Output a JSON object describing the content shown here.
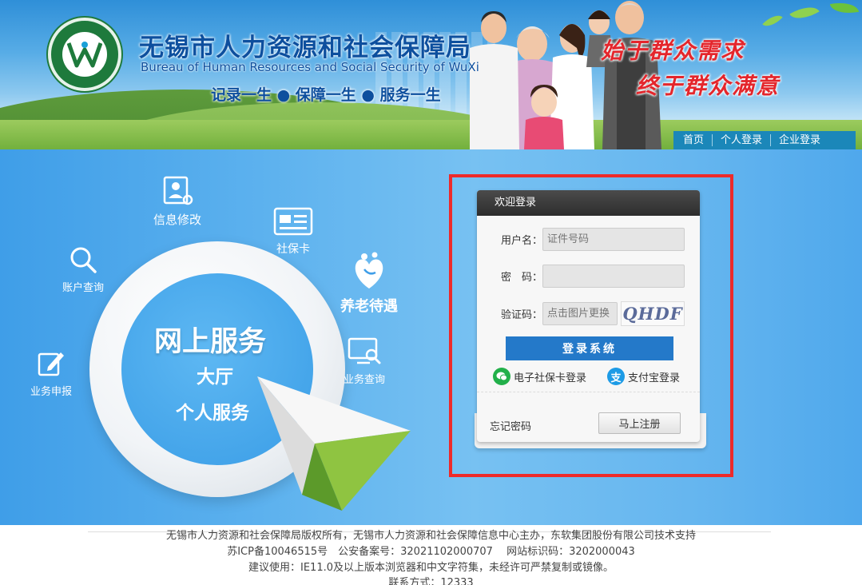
{
  "header": {
    "title_cn": "无锡市人力资源和社会保障局",
    "title_en": "Bureau of Human Resources and Social Security of WuXi",
    "slogan": "记录一生 ● 保障一生 ● 服务一生",
    "motto_line1": "始于群众需求",
    "motto_line2": "终于群众满意",
    "nav": [
      {
        "label": "首页"
      },
      {
        "label": "个人登录"
      },
      {
        "label": "企业登录"
      }
    ]
  },
  "hall": {
    "title": "网上服务",
    "sub1": "大厅",
    "sub2": "个人服务"
  },
  "services": {
    "info_modify": "信息修改",
    "social_card": "社保卡",
    "account_query": "账户查询",
    "pension": "养老待遇",
    "business_apply": "业务申报",
    "business_query": "业务查询"
  },
  "login": {
    "header": "欢迎登录",
    "username_label": "用户名：",
    "username_placeholder": "证件号码",
    "password_label": "密　码：",
    "password_placeholder": "",
    "captcha_label": "验证码：",
    "captcha_placeholder": "点击图片更换",
    "captcha_text": "QHDF",
    "submit": "登录系统",
    "ecard_login": "电子社保卡登录",
    "alipay_login": "支付宝登录",
    "forgot": "忘记密码",
    "register": "马上注册"
  },
  "footer": {
    "line1": "无锡市人力资源和社会保障局版权所有，无锡市人力资源和社会保障信息中心主办，东软集团股份有限公司技术支持",
    "line2": "苏ICP备10046515号　公安备案号：32021102000707　 网站标识码：3202000043",
    "line3": "建议使用：IE11.0及以上版本浏览器和中文字符集，未经许可严禁复制或镜像。",
    "line4": "联系方式：12333"
  },
  "colors": {
    "primary_blue": "#2479c9",
    "brand_navy": "#0d4f9e",
    "motto_red": "#e4262c",
    "highlight_red": "#ee2a2a",
    "nav_bg": "#1b87b9"
  }
}
